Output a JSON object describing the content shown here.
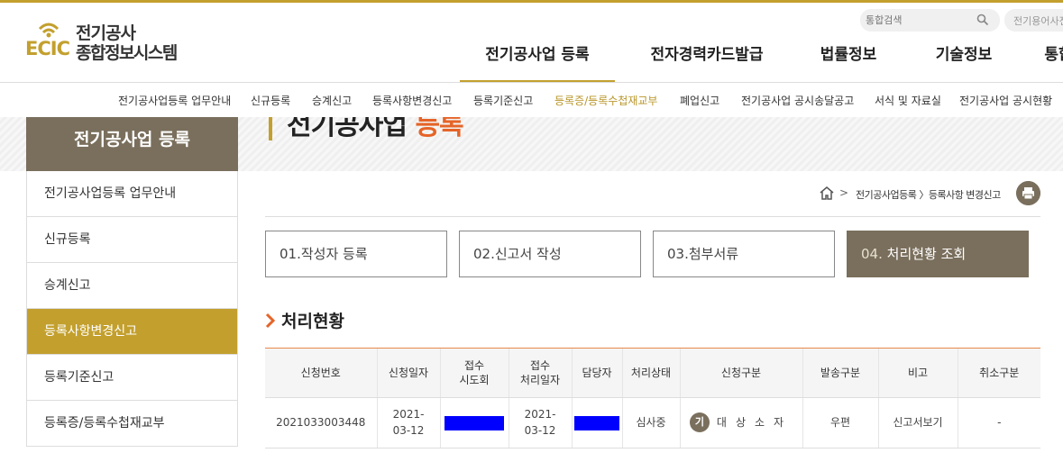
{
  "header": {
    "logo_mark": "ECIC",
    "logo_line1": "전기공사",
    "logo_line2": "종합정보시스템",
    "search_placeholder": "통합검색",
    "search2_placeholder": "전기용어사전",
    "gnb": [
      "전기공사업 등록",
      "전자경력카드발급",
      "법률정보",
      "기술정보",
      "통합"
    ]
  },
  "sub_nav": [
    "전기공사업등록 업무안내",
    "신규등록",
    "승계신고",
    "등록사항변경신고",
    "등록기준신고",
    "등록증/등록수첩재교부",
    "폐업신고",
    "전기공사업 공시송달공고",
    "서식 및 자료실",
    "전기공사업 공시현황"
  ],
  "banner": {
    "title_main": "전기공사업",
    "title_highlight": "등록"
  },
  "sidebar": {
    "title": "전기공사업 등록",
    "items": [
      "전기공사업등록 업무안내",
      "신규등록",
      "승계신고",
      "등록사항변경신고",
      "등록기준신고",
      "등록증/등록수첩재교부"
    ],
    "active_index": 3
  },
  "breadcrumb": {
    "separator": ">",
    "path": "전기공사업등록 〉등록사항 변경신고"
  },
  "steps": [
    {
      "num": "01.",
      "label": "작성자 등록"
    },
    {
      "num": "02.",
      "label": "신고서 작성"
    },
    {
      "num": "03.",
      "label": "첨부서류"
    },
    {
      "num": "04.",
      "label": "처리현황 조회"
    }
  ],
  "section_title": "처리현황",
  "table": {
    "headers": [
      [
        "신청번호"
      ],
      [
        "신청일자"
      ],
      [
        "접수",
        "시도회"
      ],
      [
        "접수",
        "처리일자"
      ],
      [
        "담당자"
      ],
      [
        "처리상태"
      ],
      [
        "신청구분"
      ],
      [
        "발송구분"
      ],
      [
        "비고"
      ],
      [
        "취소구분"
      ]
    ],
    "rows": [
      {
        "app_no": "2021033003448",
        "app_date_1": "2021-",
        "app_date_2": "03-12",
        "proc_date_1": "2021-",
        "proc_date_2": "03-12",
        "status": "심사중",
        "type_badge": "기",
        "type_text": "대상소자",
        "delivery": "우편",
        "note": "신고서보기",
        "cancel": "-"
      }
    ]
  },
  "colors": {
    "accent_gold": "#c3a02e",
    "brown": "#7a6f5d",
    "orange": "#e56428",
    "redaction": "#0000ff"
  }
}
